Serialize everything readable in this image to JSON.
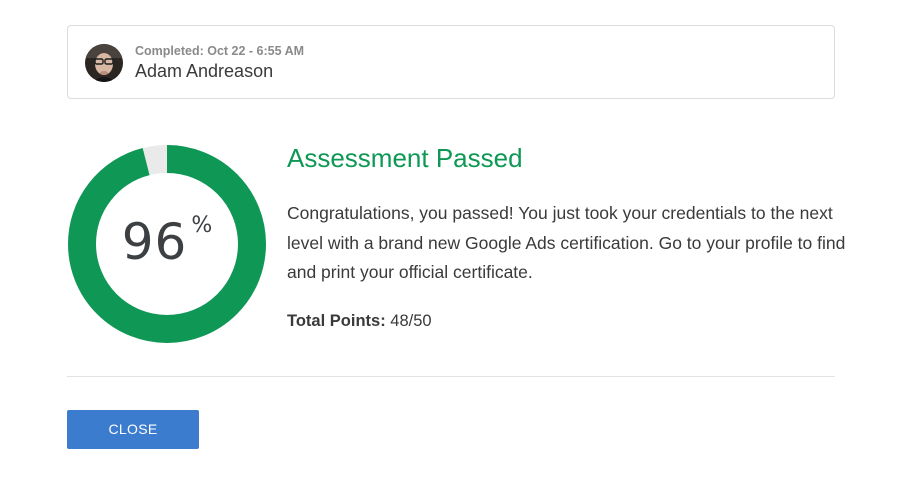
{
  "user": {
    "completed_text": "Completed: Oct 22 - 6:55 AM",
    "name": "Adam Andreason",
    "avatar_icon": "user-avatar-photo"
  },
  "result": {
    "score_value": "96",
    "score_unit": "%",
    "score_fraction": 0.96,
    "title": "Assessment Passed",
    "message": "Congratulations, you passed! You just took your credentials to the next level with a brand new Google Ads certification. Go to your profile to find and print your official certificate.",
    "points_label": "Total Points:",
    "points_value": "48/50"
  },
  "actions": {
    "close_label": "CLOSE"
  },
  "colors": {
    "success_green": "#0f9855",
    "ring_track": "#eaeaea",
    "button_blue": "#3b7ccf"
  }
}
